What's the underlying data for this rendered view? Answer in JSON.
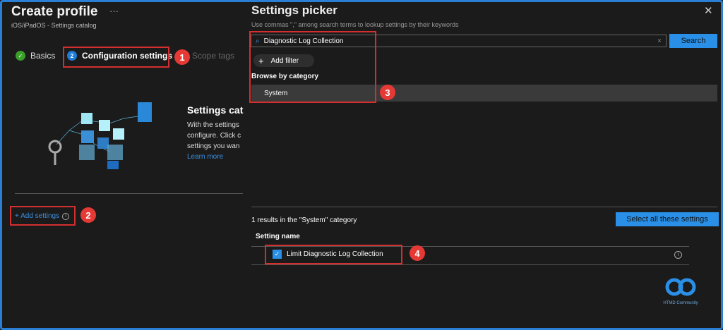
{
  "left": {
    "title": "Create profile",
    "more": "···",
    "subtitle": "iOS/iPadOS - Settings catalog",
    "tabs": [
      {
        "label": "Basics",
        "step": "✓"
      },
      {
        "label": "Configuration settings",
        "step": "2"
      },
      {
        "label": "Scope tags"
      }
    ],
    "catalog": {
      "heading": "Settings cat",
      "lines": [
        "With the settings",
        "configure. Click c",
        "settings you wan"
      ],
      "learn_more": "Learn more"
    },
    "add_settings": "+ Add settings"
  },
  "picker": {
    "title": "Settings picker",
    "hint": "Use commas \",\" among search terms to lookup settings by their keywords",
    "search_value": "Diagnostic Log Collection",
    "search_button": "Search",
    "add_filter": "Add filter",
    "browse_label": "Browse by category",
    "category": "System",
    "results_text": "1 results in the \"System\" category",
    "select_all": "Select all these settings",
    "column": "Setting name",
    "rows": [
      {
        "label": "Limit Diagnostic Log Collection",
        "checked": true
      }
    ]
  },
  "annotations": [
    "1",
    "2",
    "3",
    "4"
  ],
  "watermark": "HTMD Community",
  "colors": {
    "accent": "#2a8fe6",
    "annotation": "#e53935",
    "success": "#3aa02a"
  }
}
